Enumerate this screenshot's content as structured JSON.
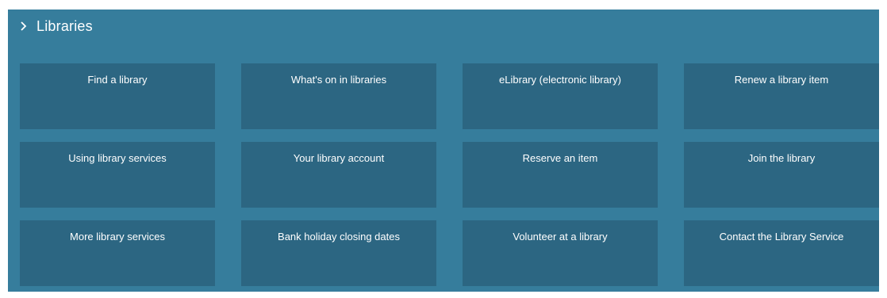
{
  "section": {
    "title": "Libraries",
    "chevron_icon": "chevron-right-icon",
    "background_color": "#367d9c",
    "tile_color": "#2c6682",
    "text_color": "#ffffff"
  },
  "tiles": [
    {
      "label": "Find a library"
    },
    {
      "label": "What's on in libraries"
    },
    {
      "label": "eLibrary (electronic library)"
    },
    {
      "label": "Renew a library item"
    },
    {
      "label": "Using library services"
    },
    {
      "label": "Your library account"
    },
    {
      "label": "Reserve an item"
    },
    {
      "label": "Join the library"
    },
    {
      "label": "More library services"
    },
    {
      "label": "Bank holiday closing dates"
    },
    {
      "label": "Volunteer at a library"
    },
    {
      "label": "Contact the Library Service"
    }
  ]
}
